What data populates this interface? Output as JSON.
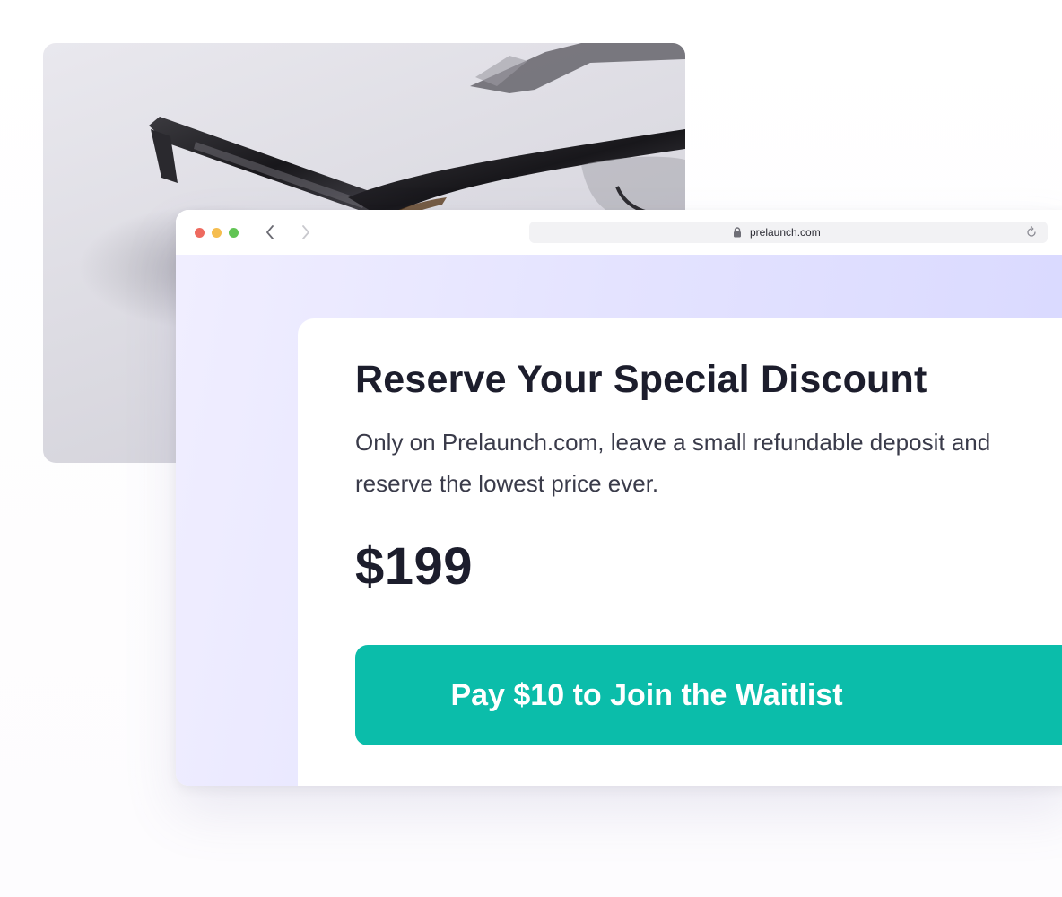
{
  "browser": {
    "url": "prelaunch.com",
    "icons": {
      "window_controls": [
        "close-dot",
        "minimize-dot",
        "maximize-dot"
      ],
      "back": "chevron-left-icon",
      "forward": "chevron-right-icon",
      "lock": "lock-icon",
      "reload": "reload-icon"
    }
  },
  "card": {
    "title": "Reserve Your Special Discount",
    "description": "Only on Prelaunch.com, leave a small refundable deposit and reserve the lowest price ever.",
    "price": "$199",
    "cta_label": "Pay $10 to Join the Waitlist"
  },
  "colors": {
    "accent": "#0bbdaa",
    "title": "#1c1d2c",
    "viewport_bg": "#e4e3ff"
  }
}
